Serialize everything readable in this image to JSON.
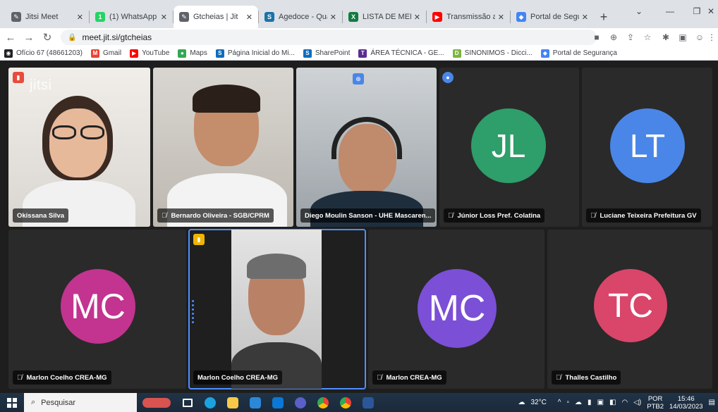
{
  "browser": {
    "tabs": [
      {
        "title": "Jitsi Meet",
        "color": "#5f6368",
        "glyph": "✎"
      },
      {
        "title": "(1) WhatsApp",
        "color": "#25d366",
        "glyph": "1"
      },
      {
        "title": "Gtcheias | Jit",
        "color": "#5f6368",
        "glyph": "✎",
        "active": true
      },
      {
        "title": "Agedoce - Quad",
        "color": "#1a73a8",
        "glyph": "S"
      },
      {
        "title": "LISTA DE MEMBR",
        "color": "#107c41",
        "glyph": "X"
      },
      {
        "title": "Transmissão ao v",
        "color": "#ff0000",
        "glyph": "▶"
      },
      {
        "title": "Portal de Segura",
        "color": "#4285f4",
        "glyph": "◆"
      }
    ],
    "url": "meet.jit.si/gtcheias",
    "bookmarks": [
      {
        "label": "Ofício 67 (48661203)",
        "color": "#202124",
        "glyph": "◉"
      },
      {
        "label": "Gmail",
        "color": "#ea4335",
        "glyph": "M"
      },
      {
        "label": "YouTube",
        "color": "#ff0000",
        "glyph": "▶"
      },
      {
        "label": "Maps",
        "color": "#34a853",
        "glyph": "●"
      },
      {
        "label": "Página Inicial do Mi...",
        "color": "#0f6cbd",
        "glyph": "S"
      },
      {
        "label": "SharePoint",
        "color": "#0f6cbd",
        "glyph": "S"
      },
      {
        "label": "ÁREA TÉCNICA - GE...",
        "color": "#5c2d91",
        "glyph": "T"
      },
      {
        "label": "SINONIMOS - Dicci...",
        "color": "#7cb342",
        "glyph": "D"
      },
      {
        "label": "Portal de Segurança",
        "color": "#4285f4",
        "glyph": "◆"
      }
    ]
  },
  "meeting": {
    "logo": "jitsi",
    "participants": [
      {
        "name": "Okissana Silva",
        "muted": false,
        "avatar": null
      },
      {
        "name": "Bernardo Oliveira - SGB/CPRM",
        "muted": true,
        "avatar": null
      },
      {
        "name": "Diego Moulin Sanson - UHE Mascaren...",
        "muted": false,
        "avatar": null
      },
      {
        "name": "Júnior Loss Pref. Colatina",
        "muted": true,
        "avatar": "JL",
        "avatar_color": "#2e9e6b"
      },
      {
        "name": "Luciane Teixeira Prefeitura GV",
        "muted": true,
        "avatar": "LT",
        "avatar_color": "#4a86e8"
      },
      {
        "name": "Marlon Coelho CREA-MG",
        "muted": true,
        "avatar": "MC",
        "avatar_color": "#c2348f"
      },
      {
        "name": "Marlon Coelho CREA-MG",
        "muted": false,
        "avatar": null
      },
      {
        "name": "Marlon CREA-MG",
        "muted": true,
        "avatar": "MC",
        "avatar_color": "#7b4fd6"
      },
      {
        "name": "Thalles Castilho",
        "muted": true,
        "avatar": "TC",
        "avatar_color": "#d9466a"
      }
    ]
  },
  "taskbar": {
    "search_placeholder": "Pesquisar",
    "weather": "32°C",
    "lang": "POR",
    "layout": "PTB2",
    "time": "15:46",
    "date": "14/03/2023"
  }
}
